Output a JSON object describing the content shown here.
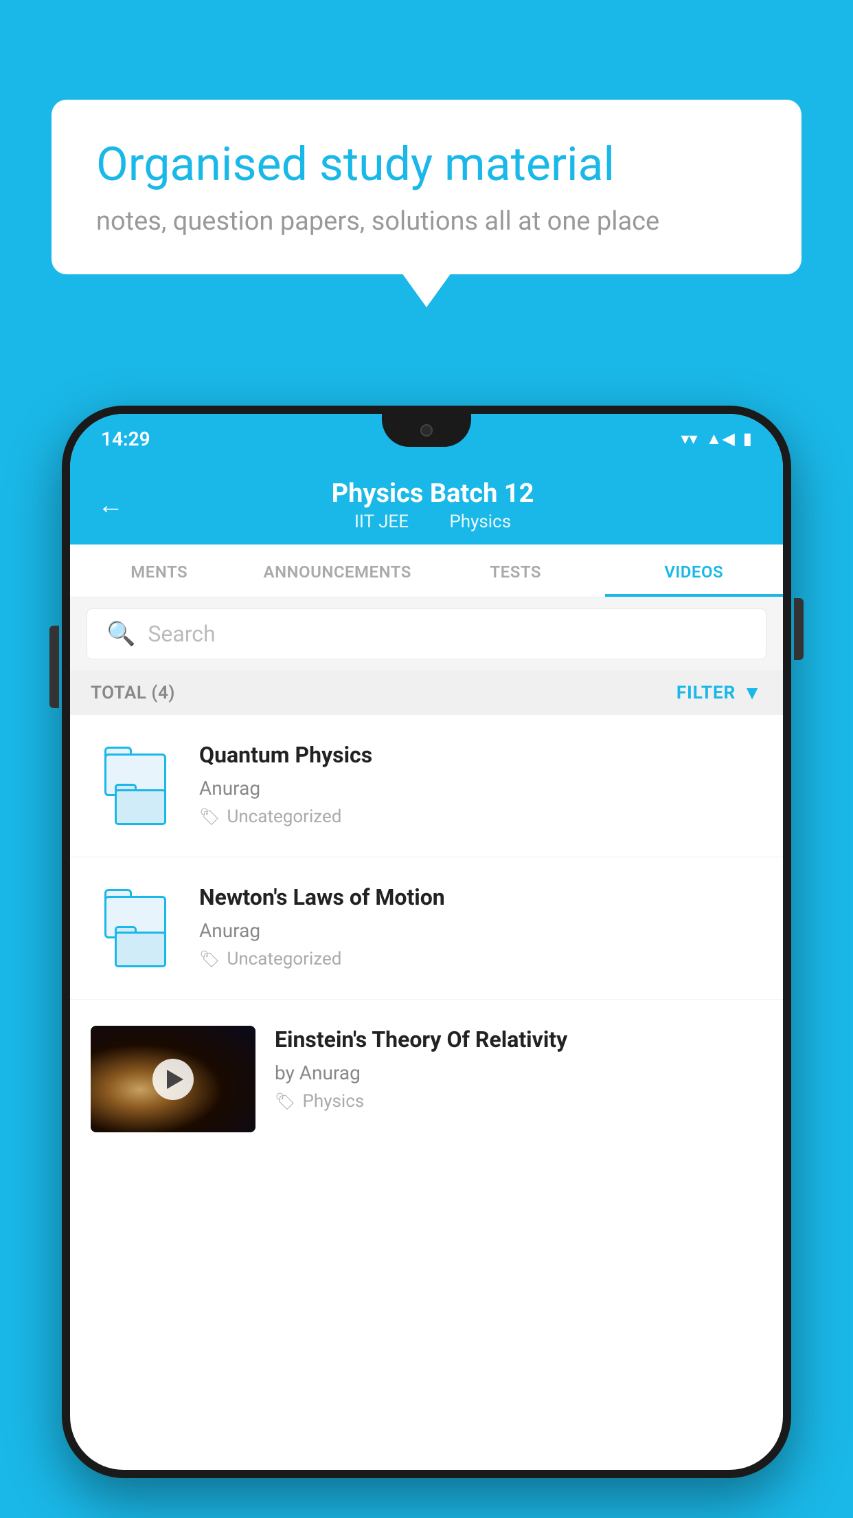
{
  "page": {
    "background_color": "#1ab8e8"
  },
  "speech_bubble": {
    "title": "Organised study material",
    "subtitle": "notes, question papers, solutions all at one place"
  },
  "status_bar": {
    "time": "14:29",
    "wifi": "▾",
    "signal": "▲",
    "battery": "▮"
  },
  "app_header": {
    "back_label": "←",
    "title": "Physics Batch 12",
    "subtitle_left": "IIT JEE",
    "subtitle_right": "Physics"
  },
  "tabs": [
    {
      "label": "MENTS",
      "active": false
    },
    {
      "label": "ANNOUNCEMENTS",
      "active": false
    },
    {
      "label": "TESTS",
      "active": false
    },
    {
      "label": "VIDEOS",
      "active": true
    }
  ],
  "search": {
    "placeholder": "Search"
  },
  "filter_bar": {
    "total_label": "TOTAL (4)",
    "filter_label": "FILTER"
  },
  "videos": [
    {
      "title": "Quantum Physics",
      "author": "Anurag",
      "tag": "Uncategorized",
      "has_thumbnail": false
    },
    {
      "title": "Newton's Laws of Motion",
      "author": "Anurag",
      "tag": "Uncategorized",
      "has_thumbnail": false
    },
    {
      "title": "Einstein's Theory Of Relativity",
      "author": "by Anurag",
      "tag": "Physics",
      "has_thumbnail": true
    }
  ]
}
